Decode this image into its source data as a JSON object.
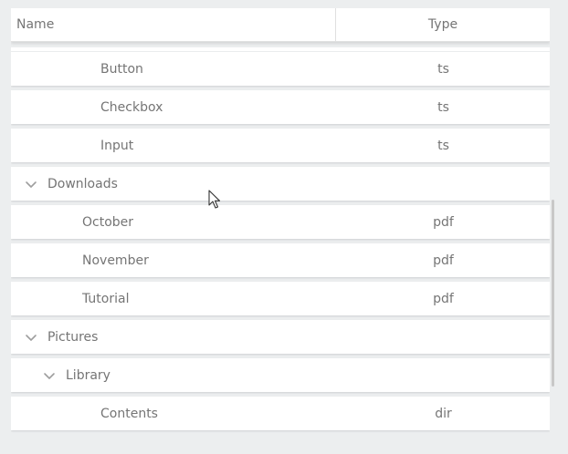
{
  "columns": {
    "name": "Name",
    "type": "Type"
  },
  "rows": [
    {
      "label": "Button",
      "type": "ts",
      "level": 2,
      "expandable": false
    },
    {
      "label": "Checkbox",
      "type": "ts",
      "level": 2,
      "expandable": false
    },
    {
      "label": "Input",
      "type": "ts",
      "level": 2,
      "expandable": false
    },
    {
      "label": "Downloads",
      "type": "",
      "level": 0,
      "expandable": true
    },
    {
      "label": "October",
      "type": "pdf",
      "level": 1,
      "expandable": false
    },
    {
      "label": "November",
      "type": "pdf",
      "level": 1,
      "expandable": false
    },
    {
      "label": "Tutorial",
      "type": "pdf",
      "level": 1,
      "expandable": false
    },
    {
      "label": "Pictures",
      "type": "",
      "level": 0,
      "expandable": true
    },
    {
      "label": "Library",
      "type": "",
      "level": 1,
      "expandable": true
    },
    {
      "label": "Contents",
      "type": "dir",
      "level": 2,
      "expandable": false
    }
  ],
  "icons": {
    "expand": "chevron-down-icon",
    "cursor": "mouse-pointer-icon"
  },
  "colors": {
    "background": "#eceeef",
    "row": "#ffffff",
    "text": "#757575",
    "chevron": "#9e9e9e"
  }
}
